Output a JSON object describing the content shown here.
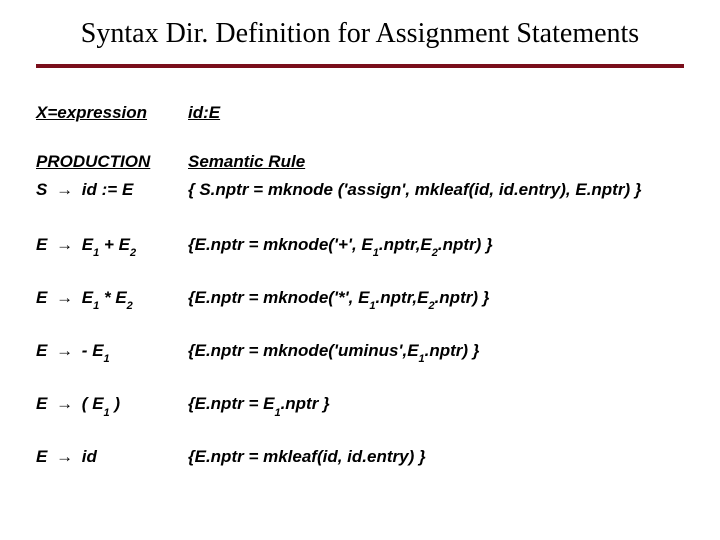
{
  "title": "Syntax Dir. Definition for Assignment Statements",
  "xline": {
    "left": "X=expression",
    "right": "id:E"
  },
  "headers": {
    "left": "PRODUCTION",
    "right": "Semantic Rule"
  },
  "arrow": "→",
  "rows": [
    {
      "prod": {
        "lhs": "S",
        "rhs_plain": "id := E"
      },
      "sem": "{ S.nptr = mknode ('assign', mkleaf(id, id.entry), E.nptr) }"
    },
    {
      "prod": {
        "lhs": "E",
        "rhs_seq": [
          "E",
          "1",
          " + ",
          "E",
          "2"
        ]
      },
      "sem_seq": [
        "{E.nptr = mknode('+', E",
        "1",
        ".nptr,E",
        "2",
        ".nptr) }"
      ]
    },
    {
      "prod": {
        "lhs": "E",
        "rhs_seq": [
          "E",
          "1",
          " * ",
          "E",
          "2"
        ]
      },
      "sem_seq": [
        "{E.nptr = mknode('*', E",
        "1",
        ".nptr,E",
        "2",
        ".nptr) }"
      ]
    },
    {
      "prod": {
        "lhs": "E",
        "rhs_seq": [
          "- ",
          "E",
          "1"
        ]
      },
      "sem_seq": [
        "{E.nptr = mknode('uminus',E",
        "1",
        ".nptr) }"
      ]
    },
    {
      "prod": {
        "lhs": "E",
        "rhs_seq": [
          "( ",
          "E",
          "1",
          " )"
        ]
      },
      "sem_seq": [
        "{E.nptr = E",
        "1",
        ".nptr }"
      ]
    },
    {
      "prod": {
        "lhs": "E",
        "rhs_plain": "id"
      },
      "sem": "{E.nptr = mkleaf(id, id.entry) }"
    }
  ]
}
